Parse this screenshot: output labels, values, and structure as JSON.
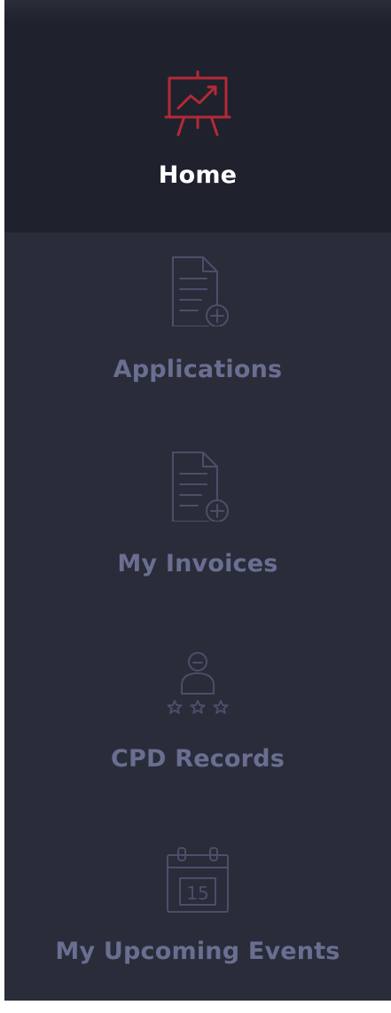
{
  "sidebar": {
    "active_index": 0,
    "items": [
      {
        "label": "Home",
        "icon": "presentation-chart-icon"
      },
      {
        "label": "Applications",
        "icon": "document-add-icon"
      },
      {
        "label": "My Invoices",
        "icon": "invoice-add-icon"
      },
      {
        "label": "CPD Records",
        "icon": "user-rating-icon"
      },
      {
        "label": "My Upcoming Events",
        "icon": "calendar-icon",
        "icon_text": "15"
      }
    ]
  },
  "colors": {
    "sidebar_bg": "#2a2c3a",
    "active_bg": "#1f212d",
    "active_label": "#ffffff",
    "inactive_label": "#6a6f91",
    "accent_red": "#b32a35",
    "icon_dim": "#4b4f68"
  }
}
